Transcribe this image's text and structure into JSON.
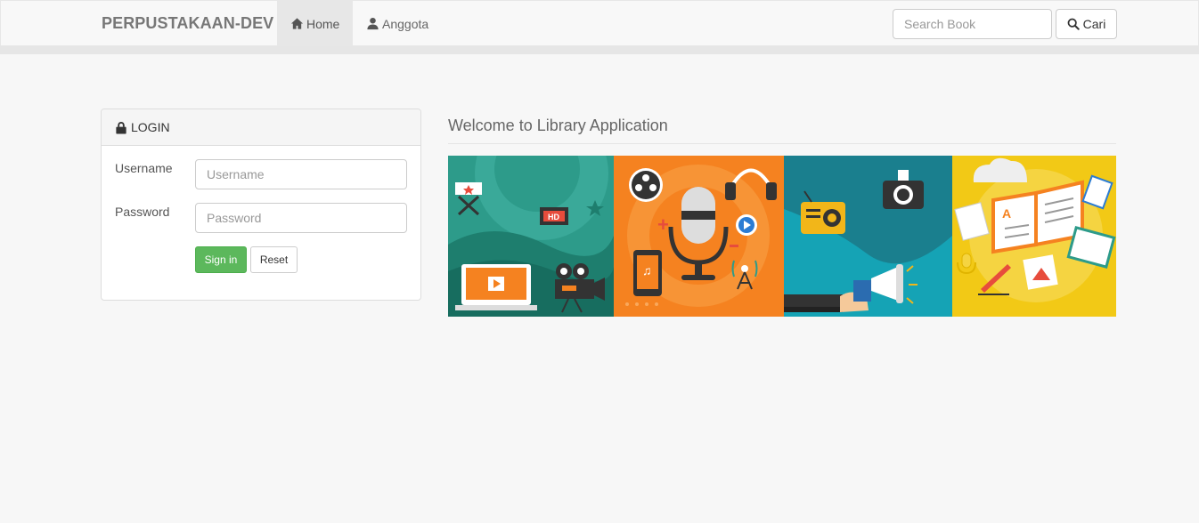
{
  "navbar": {
    "brand": "PERPUSTAKAAN-DEV",
    "items": [
      {
        "label": "Home",
        "icon": "home-icon",
        "active": true
      },
      {
        "label": "Anggota",
        "icon": "user-icon",
        "active": false
      }
    ],
    "search": {
      "placeholder": "Search Book",
      "value": "",
      "button_label": "Cari",
      "button_icon": "search-icon"
    }
  },
  "login": {
    "title": "LOGIN",
    "title_icon": "lock-icon",
    "username_label": "Username",
    "username_placeholder": "Username",
    "password_label": "Password",
    "password_placeholder": "Password",
    "signin_label": "Sign in",
    "reset_label": "Reset"
  },
  "welcome": {
    "title": "Welcome to Library Application",
    "banner_badge": "HD"
  },
  "colors": {
    "success": "#5cb85c",
    "banner_green": "#2a9d8f",
    "banner_orange": "#f58220",
    "banner_teal": "#1a7f8e",
    "banner_yellow": "#f2c916"
  }
}
